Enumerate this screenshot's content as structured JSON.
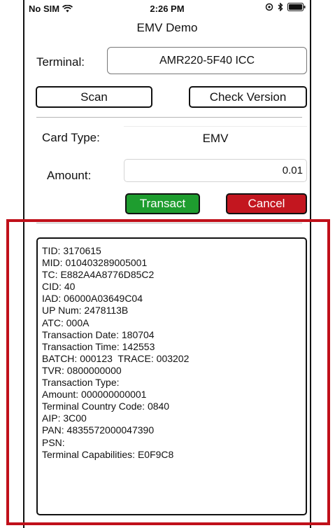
{
  "status_bar": {
    "carrier": "No SIM",
    "time": "2:26 PM"
  },
  "nav": {
    "title": "EMV Demo"
  },
  "terminal": {
    "label": "Terminal:",
    "value": "AMR220-5F40 ICC"
  },
  "actions": {
    "scan_label": "Scan",
    "check_version_label": "Check Version"
  },
  "card_type": {
    "label": "Card Type:",
    "value": "EMV"
  },
  "amount": {
    "label": "Amount:",
    "value": "0.01"
  },
  "transaction_buttons": {
    "transact_label": "Transact",
    "cancel_label": "Cancel",
    "transact_color": "#1e9d2f",
    "cancel_color": "#c3161f"
  },
  "annotation_color": "#c0101a",
  "output_lines": [
    "TID: 3170615",
    "MID: 010403289005001",
    "TC: E882A4A8776D85C2",
    "CID: 40",
    "IAD: 06000A03649C04",
    "UP Num: 2478113B",
    "ATC: 000A",
    "Transaction Date: 180704",
    "Transaction Time: 142553",
    "BATCH: 000123  TRACE: 003202",
    "TVR: 0800000000",
    "Transaction Type:",
    "Amount: 000000000001",
    "Terminal Country Code: 0840",
    "AIP: 3C00",
    "PAN: 4835572000047390",
    "PSN:",
    "Terminal Capabilities: E0F9C8"
  ]
}
